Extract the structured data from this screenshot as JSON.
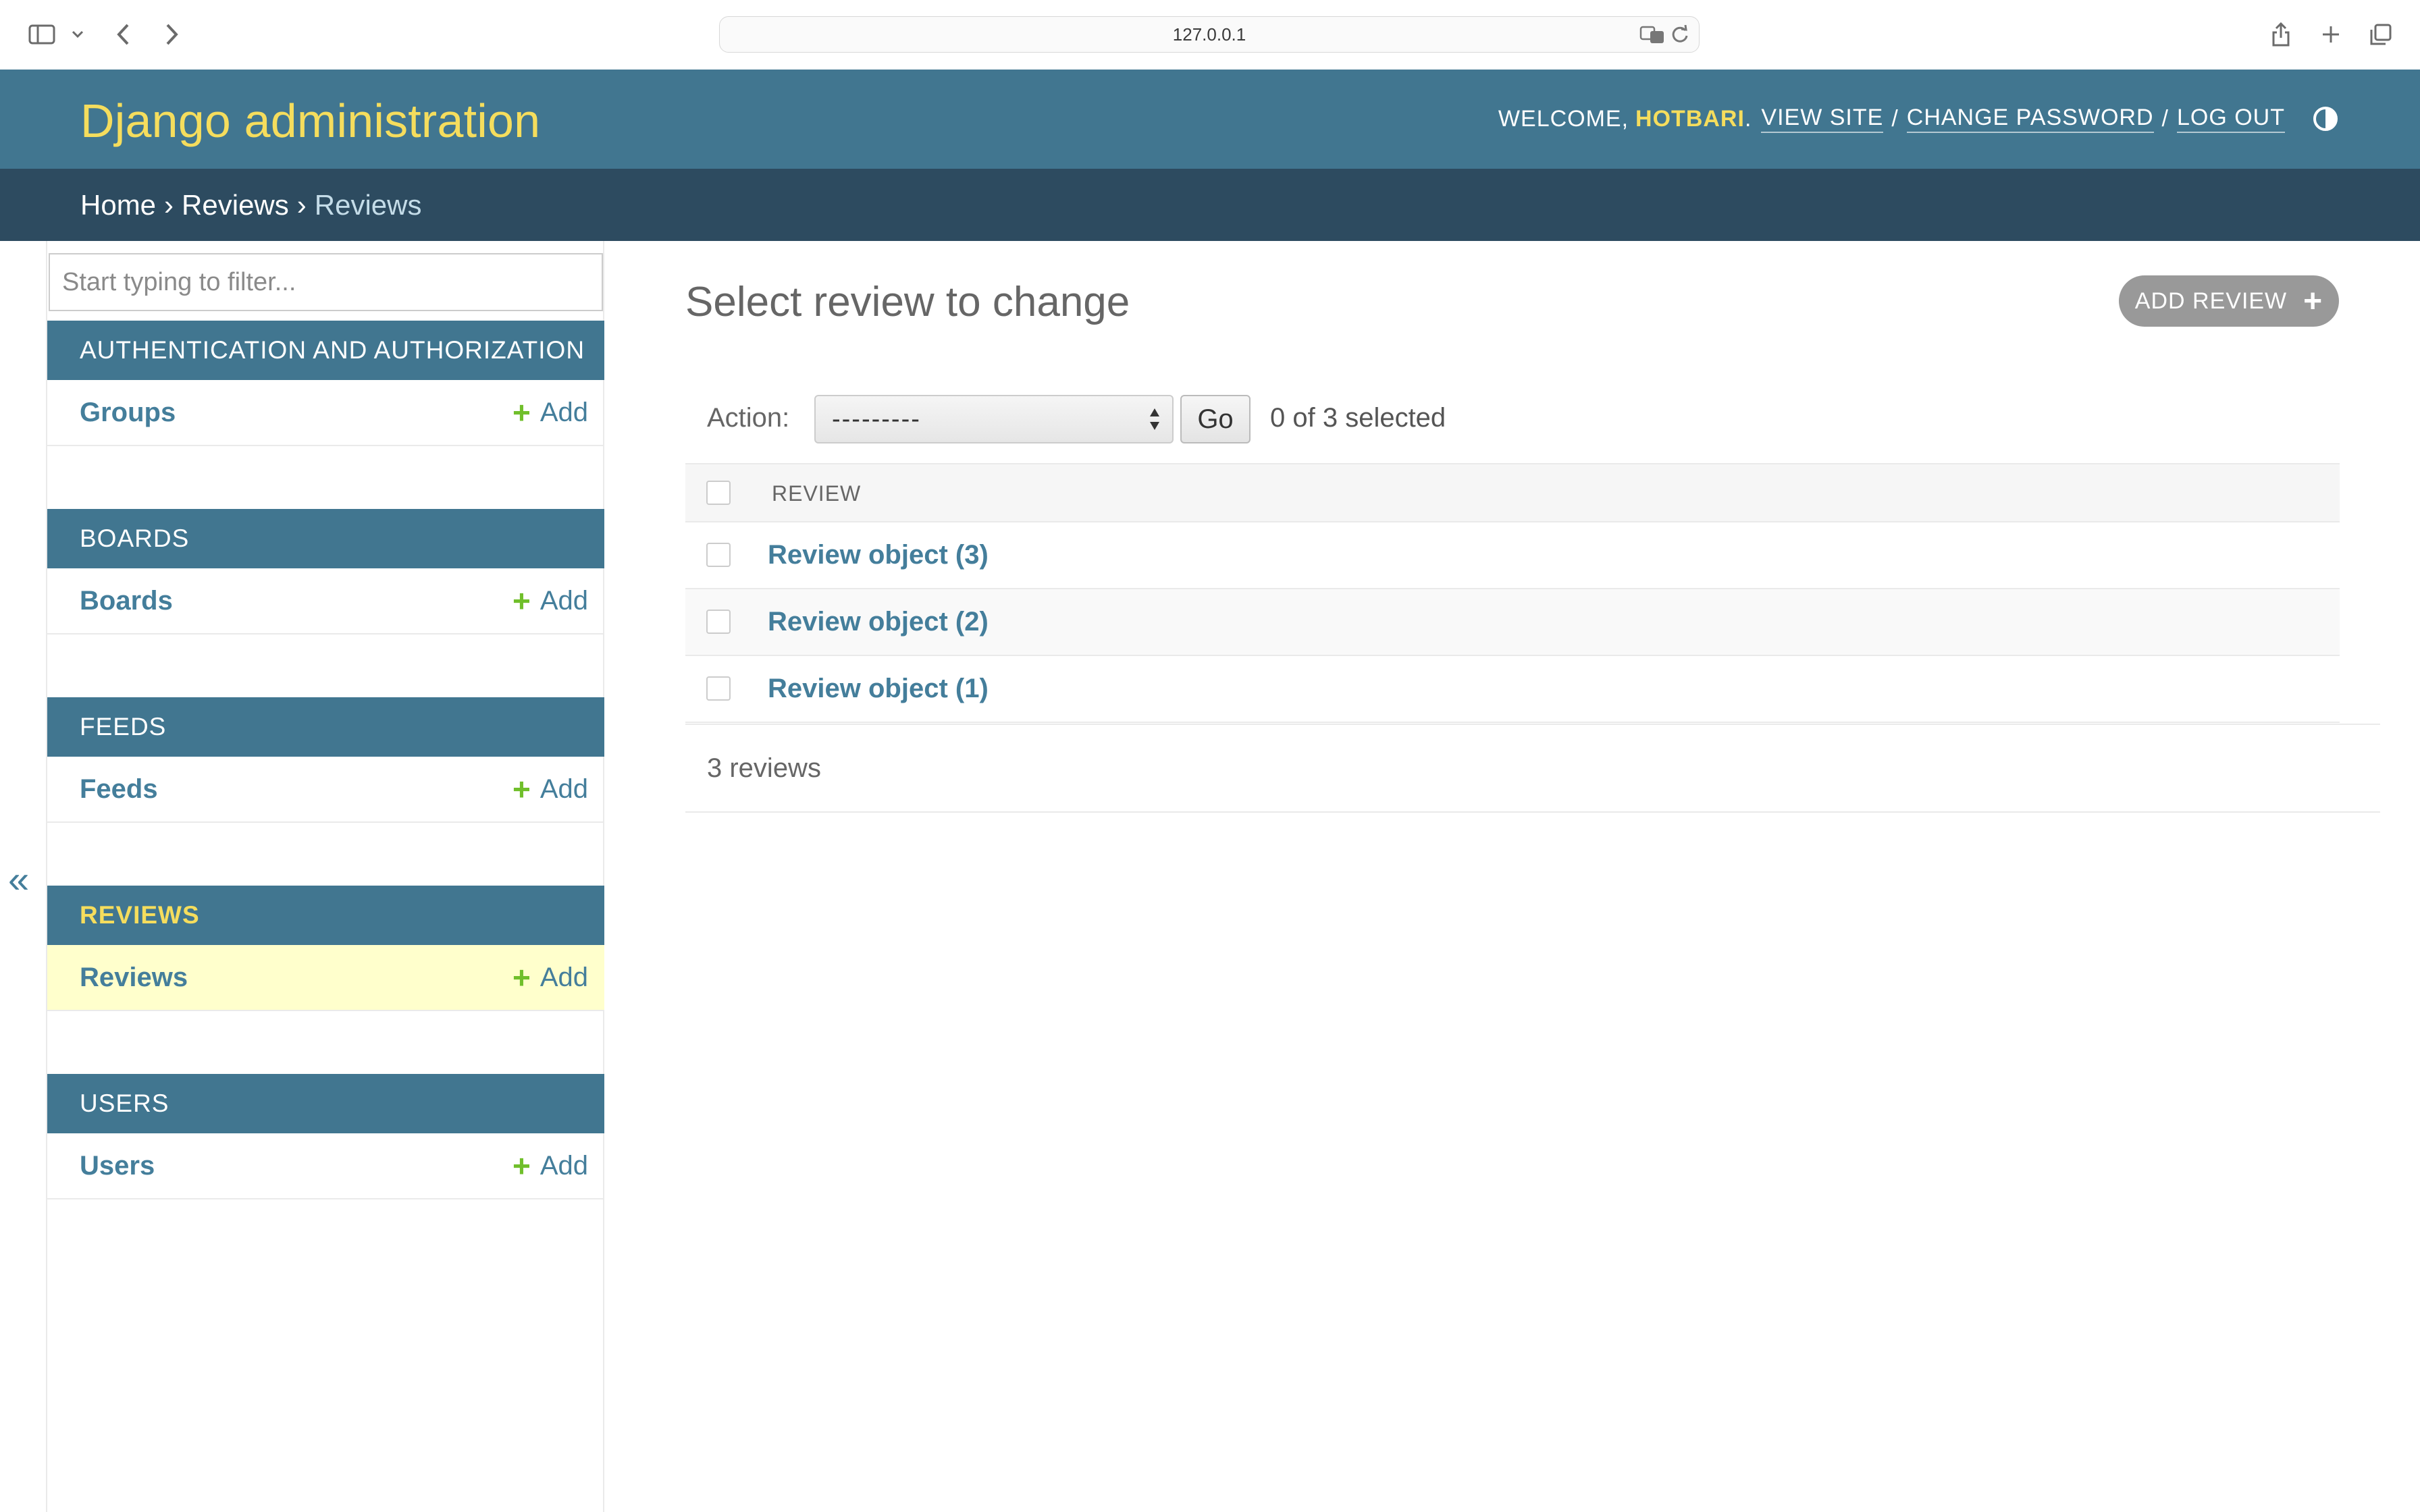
{
  "browser": {
    "url": "127.0.0.1"
  },
  "header": {
    "branding": "Django administration",
    "welcome": "WELCOME,",
    "username": "HOTBARI",
    "period": ".",
    "view_site": "VIEW SITE",
    "change_password": "CHANGE PASSWORD",
    "log_out": "LOG OUT",
    "separator": "/"
  },
  "breadcrumbs": {
    "home": "Home",
    "app": "Reviews",
    "current": "Reviews",
    "separator": "›"
  },
  "sidebar": {
    "filter_placeholder": "Start typing to filter...",
    "add_label": "Add",
    "collapse_glyph": "«",
    "modules": [
      {
        "caption": "AUTHENTICATION AND AUTHORIZATION",
        "model": "Groups"
      },
      {
        "caption": "BOARDS",
        "model": "Boards"
      },
      {
        "caption": "FEEDS",
        "model": "Feeds"
      },
      {
        "caption": "REVIEWS",
        "model": "Reviews"
      },
      {
        "caption": "USERS",
        "model": "Users"
      }
    ]
  },
  "content": {
    "title": "Select review to change",
    "add_button": "ADD REVIEW",
    "action_label": "Action:",
    "action_value": "---------",
    "go_label": "Go",
    "selected_count": "0 of 3 selected",
    "column_header": "REVIEW",
    "rows": [
      "Review object (3)",
      "Review object (2)",
      "Review object (1)"
    ],
    "paginator": "3 reviews"
  },
  "colors": {
    "header_bg": "#417690",
    "breadcrumbs_bg": "#2d4b60",
    "branding": "#f5dd5d",
    "link": "#447e9b",
    "add_plus": "#70bf2b",
    "current_row_bg": "#ffffcc"
  }
}
